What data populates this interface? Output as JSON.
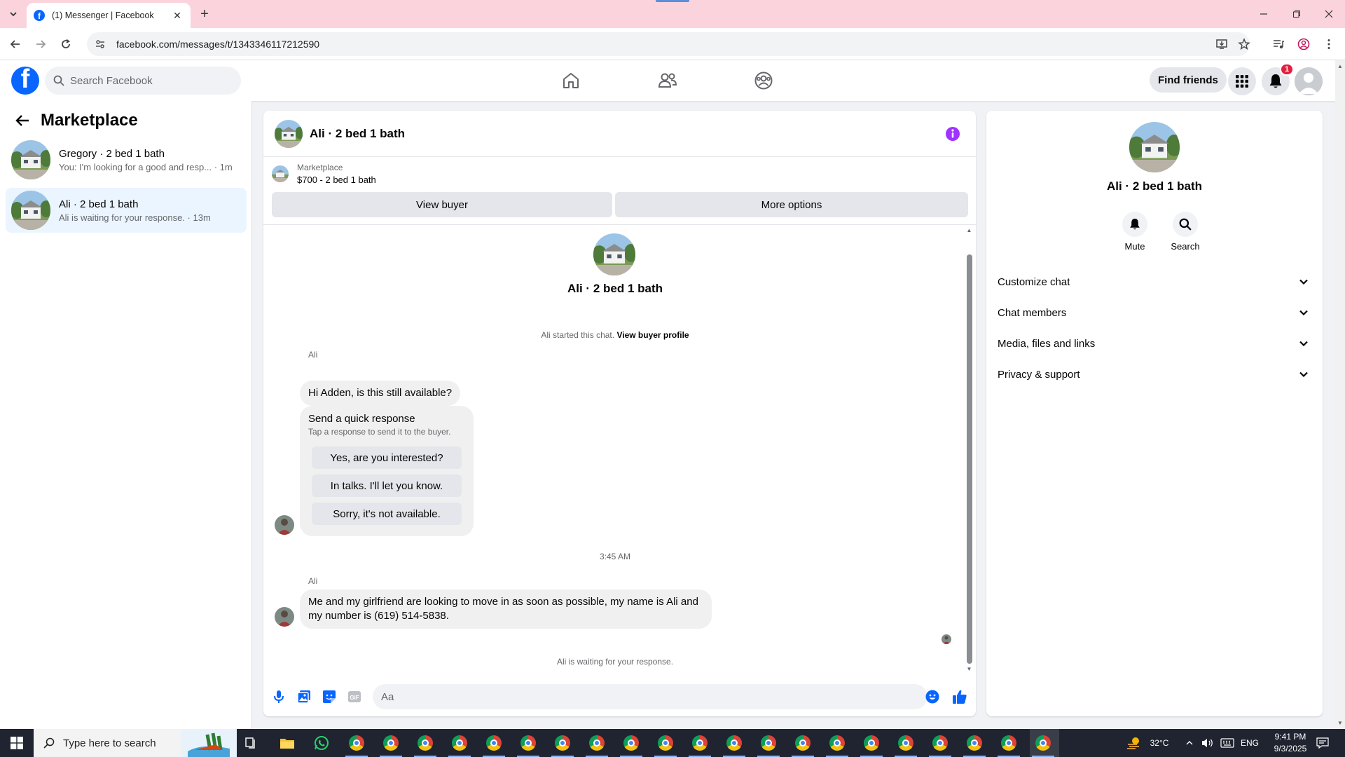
{
  "browser": {
    "tab_title": "(1) Messenger | Facebook",
    "tab_favicon": "f",
    "url": "facebook.com/messages/t/1343346117212590"
  },
  "facebook": {
    "logo_letter": "f",
    "search_placeholder": "Search Facebook",
    "find_friends_label": "Find friends",
    "notification_count": "1",
    "brand_color": "#0866ff"
  },
  "sidebar": {
    "title": "Marketplace",
    "conversations": [
      {
        "name": "Gregory · 2 bed 1 bath",
        "preview": "You: I'm looking for a good and resp...",
        "time": "1m",
        "active": false
      },
      {
        "name": "Ali · 2 bed 1 bath",
        "preview": "Ali is waiting for your response.",
        "time": "13m",
        "active": true
      }
    ]
  },
  "chat": {
    "header_title": "Ali · 2 bed 1 bath",
    "listing_source": "Marketplace",
    "listing_price": "$700 - 2 bed 1 bath",
    "view_buyer_label": "View buyer",
    "more_options_label": "More options",
    "thread_name": "Ali · 2 bed 1 bath",
    "started_text": "Ali started this chat.",
    "view_profile_link": "View buyer profile",
    "messages": [
      {
        "sender": "Ali",
        "text": "Hi Adden, is this still available?"
      },
      {
        "sender": "Ali",
        "text": "Me and my girlfriend are looking to move in as soon as possible, my name is Ali and my number is (619) 514-5838."
      }
    ],
    "quick_response": {
      "title": "Send a quick response",
      "subtitle": "Tap a response to send it to the buyer.",
      "options": [
        "Yes, are you interested?",
        "In talks. I'll let you know.",
        "Sorry, it's not available."
      ]
    },
    "timestamp": "3:45 AM",
    "waiting_text": "Ali is waiting for your response.",
    "composer_placeholder": "Aa",
    "accent_color": "#0866ff",
    "info_color": "#a033ff"
  },
  "info_panel": {
    "name": "Ali · 2 bed 1 bath",
    "actions": [
      {
        "label": "Mute",
        "icon": "bell-icon"
      },
      {
        "label": "Search",
        "icon": "search-icon"
      }
    ],
    "sections": [
      "Customize chat",
      "Chat members",
      "Media, files and links",
      "Privacy & support"
    ]
  },
  "taskbar": {
    "search_placeholder": "Type here to search",
    "temperature": "32°C",
    "language": "ENG",
    "time": "9:41 PM",
    "date": "9/3/2025"
  }
}
